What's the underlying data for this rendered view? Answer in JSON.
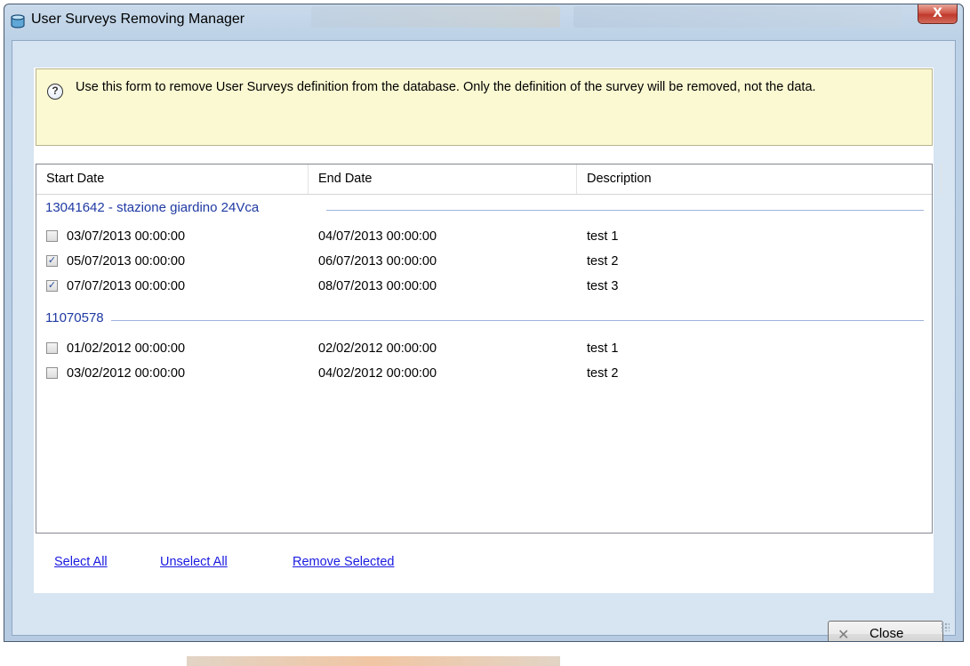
{
  "window": {
    "title": "User Surveys Removing Manager",
    "title_icon": "database-icon",
    "close_glyph": "X"
  },
  "info": {
    "icon": "help-icon",
    "text": "Use this form to remove User Surveys definition from the database. Only the definition of the survey will be removed, not the data."
  },
  "list": {
    "columns": [
      "Start Date",
      "End Date",
      "Description"
    ],
    "groups": [
      {
        "name": "13041642 - stazione giardino 24Vca",
        "rows": [
          {
            "checked": false,
            "start": "03/07/2013 00:00:00",
            "end": "04/07/2013 00:00:00",
            "description": "test 1"
          },
          {
            "checked": true,
            "start": "05/07/2013 00:00:00",
            "end": "06/07/2013 00:00:00",
            "description": "test 2"
          },
          {
            "checked": true,
            "start": "07/07/2013 00:00:00",
            "end": "08/07/2013 00:00:00",
            "description": "test 3"
          }
        ]
      },
      {
        "name": "11070578",
        "rows": [
          {
            "checked": false,
            "start": "01/02/2012 00:00:00",
            "end": "02/02/2012 00:00:00",
            "description": "test 1"
          },
          {
            "checked": false,
            "start": "03/02/2012 00:00:00",
            "end": "04/02/2012 00:00:00",
            "description": "test 2"
          }
        ]
      }
    ]
  },
  "links": {
    "select_all": "Select All",
    "unselect_all": "Unselect All",
    "remove_selected": "Remove Selected"
  },
  "buttons": {
    "close_label": "Close",
    "close_icon": "close-icon"
  },
  "colors": {
    "group_header": "#1f3aa3",
    "info_background": "#fbf9d2",
    "link": "#1a1ae0"
  }
}
